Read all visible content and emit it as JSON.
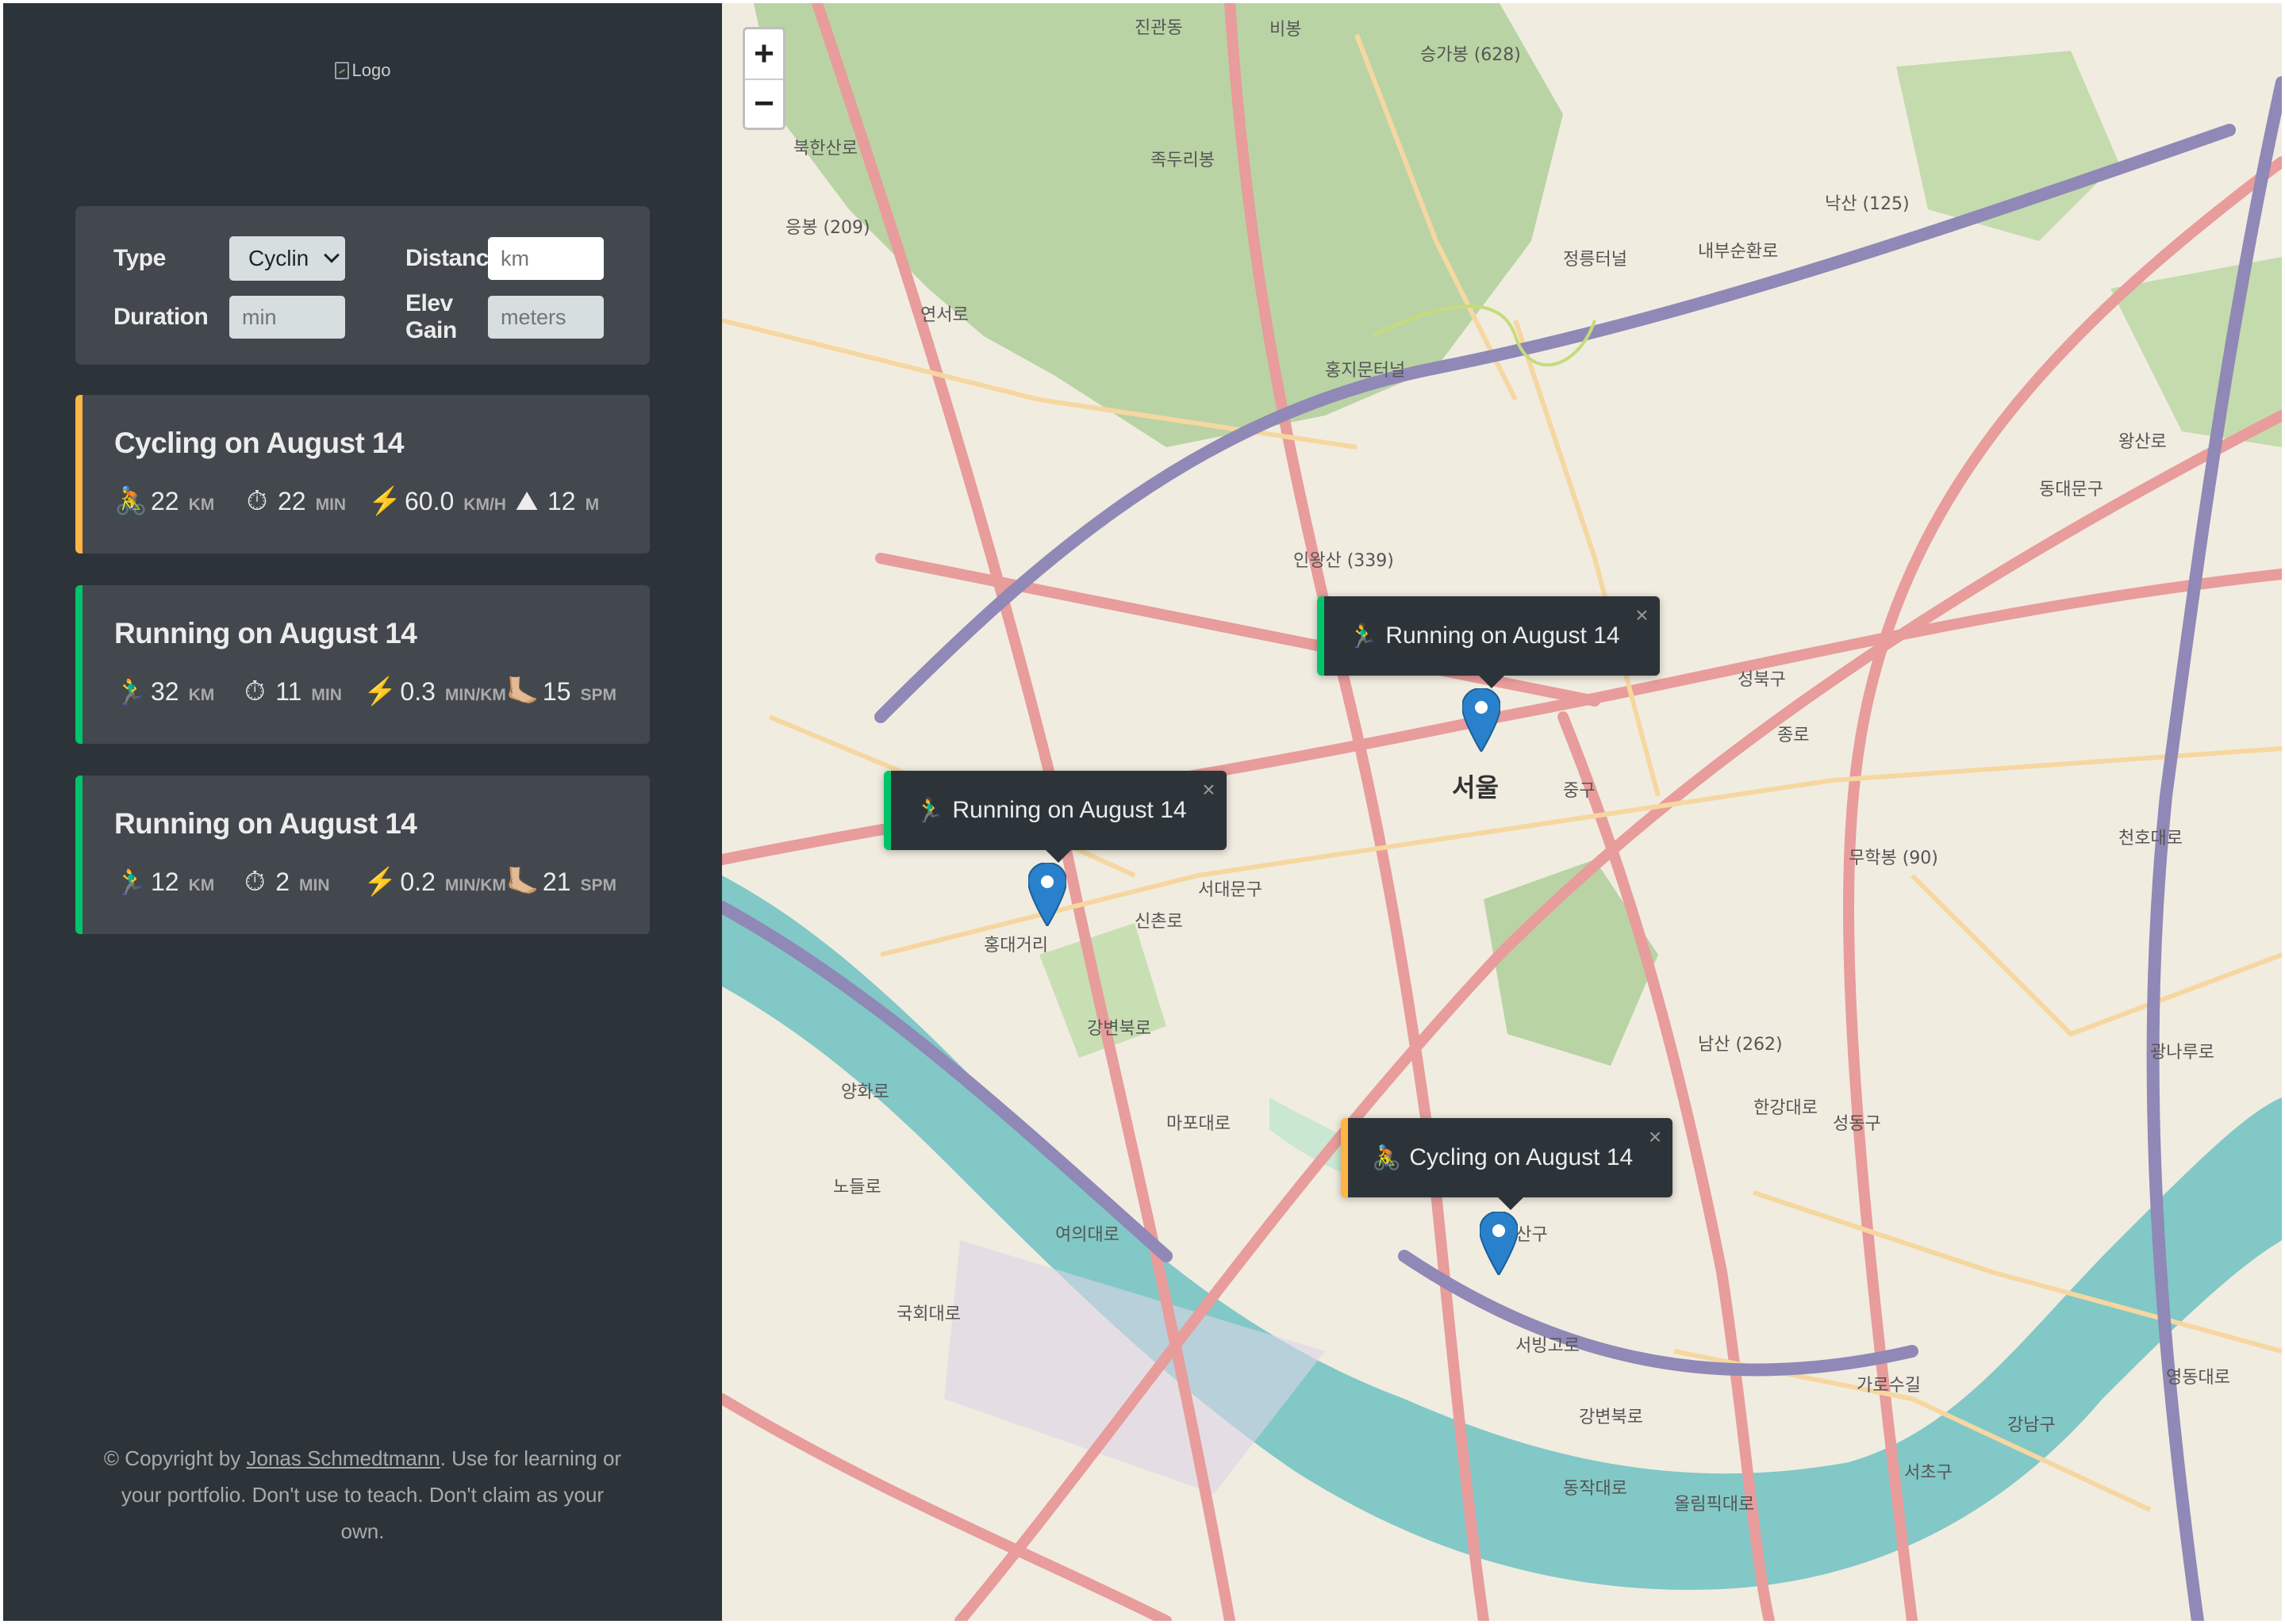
{
  "logo": {
    "alt": "Logo"
  },
  "form": {
    "type_label": "Type",
    "type_value": "Cyclin",
    "distance_label": "Distance",
    "distance_placeholder": "km",
    "duration_label": "Duration",
    "duration_placeholder": "min",
    "elev_label": "Elev Gain",
    "elev_placeholder": "meters"
  },
  "workouts": [
    {
      "kind": "cycling",
      "title": "Cycling on August 14",
      "accent": "#ffb545",
      "details": [
        {
          "icon": "🚴",
          "value": "22",
          "unit": "km"
        },
        {
          "icon": "⏱",
          "value": "22",
          "unit": "min"
        },
        {
          "icon": "⚡️",
          "value": "60.0",
          "unit": "km/h"
        },
        {
          "icon": "⛰",
          "value": "12",
          "unit": "m"
        }
      ]
    },
    {
      "kind": "running",
      "title": "Running on August 14",
      "accent": "#00c46a",
      "details": [
        {
          "icon": "🏃‍♂️",
          "value": "32",
          "unit": "km"
        },
        {
          "icon": "⏱",
          "value": "11",
          "unit": "min"
        },
        {
          "icon": "⚡️",
          "value": "0.3",
          "unit": "min/km"
        },
        {
          "icon": "🦶🏼",
          "value": "15",
          "unit": "spm"
        }
      ]
    },
    {
      "kind": "running",
      "title": "Running on August 14",
      "accent": "#00c46a",
      "details": [
        {
          "icon": "🏃‍♂️",
          "value": "12",
          "unit": "km"
        },
        {
          "icon": "⏱",
          "value": "2",
          "unit": "min"
        },
        {
          "icon": "⚡️",
          "value": "0.2",
          "unit": "min/km"
        },
        {
          "icon": "🦶🏼",
          "value": "21",
          "unit": "spm"
        }
      ]
    }
  ],
  "footer": {
    "prefix": "© Copyright by ",
    "author": "Jonas Schmedtmann",
    "suffix": ". Use for learning or your portfolio. Don't use to teach. Don't claim as your own."
  },
  "map": {
    "zoom_in": "+",
    "zoom_out": "−",
    "close": "×",
    "popups": [
      {
        "icon": "🏃‍♂️",
        "text": "Running on August 14",
        "kind": "running"
      },
      {
        "icon": "🏃‍♂️",
        "text": "Running on August 14",
        "kind": "running"
      },
      {
        "icon": "🚴",
        "text": "Cycling on August 14",
        "kind": "cycling"
      }
    ],
    "labels": [
      "진관동",
      "비봉",
      "승가봉 (628)",
      "족두리봉",
      "북한산로",
      "정릉터널",
      "내부순환로",
      "응봉 (209)",
      "연서로",
      "홍지문터널",
      "인왕산 (339)",
      "낙산 (125)",
      "서울",
      "종로",
      "중구",
      "서대문구",
      "신촌로",
      "홍대거리",
      "강변북로",
      "양화로",
      "국회대로",
      "여의대로",
      "마포대로",
      "노들로",
      "용산구",
      "강변북로",
      "올림픽대로",
      "서빙고로",
      "한강대로",
      "남산 (262)",
      "무학봉 (90)",
      "성동구",
      "광나루로",
      "동작대로",
      "서초구",
      "가로수길",
      "강남구",
      "영동대로",
      "천호대로",
      "왕산로",
      "동대문구",
      "성북구"
    ],
    "colors": {
      "land": "#f1ece0",
      "park": "#b9d3a5",
      "water": "#81c8c7",
      "major_road": "#e89c9b",
      "minor_road": "#f6d7a1",
      "expressway": "#9088b6",
      "marker": "#2a81cb"
    }
  }
}
